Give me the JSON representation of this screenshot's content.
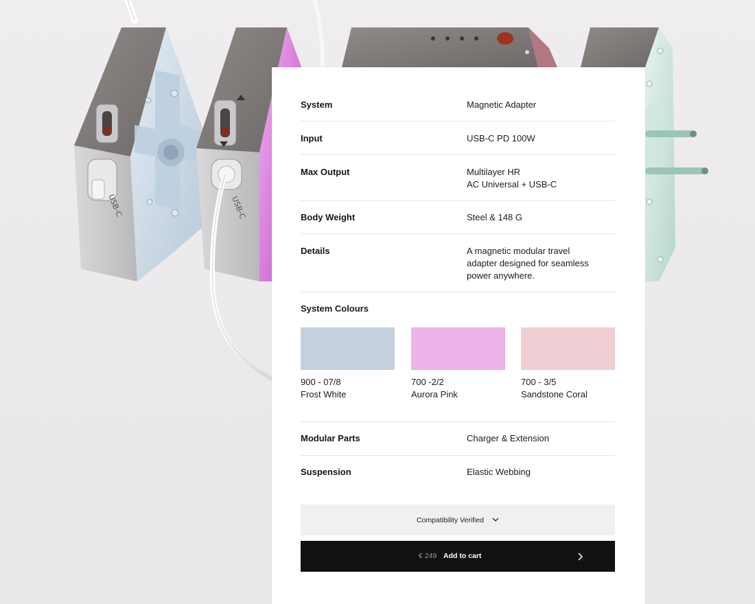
{
  "specs": [
    {
      "label": "System",
      "value": "Magnetic Adapter"
    },
    {
      "label": "Input",
      "value": "USB-C PD 100W"
    },
    {
      "label": "Max Output",
      "value_line1": "Multilayer HR",
      "value_line2": "AC Universal + USB-C"
    },
    {
      "label": "Body Weight",
      "value": "Steel & 148 G"
    },
    {
      "label": "Details",
      "value_line1": "A magnetic modular travel",
      "value_line2": "adapter designed for seamless",
      "value_line3": "power anywhere."
    }
  ],
  "colours": {
    "label": "System Colours",
    "swatches": [
      {
        "code": "900 - 07/8",
        "name": "Frost White",
        "color": "#c4d0dd"
      },
      {
        "code": "700 -2/2",
        "name": "Aurora Pink",
        "color": "#ecb4e8"
      },
      {
        "code": "700 - 3/5",
        "name": "Sandstone Coral",
        "color": "#f0cfd4"
      }
    ]
  },
  "specs_lower": [
    {
      "label": "Modular Parts",
      "value": "Charger & Extension"
    },
    {
      "label": "Suspension",
      "value": "Elastic Webbing"
    }
  ],
  "compatibility": {
    "label": "Compatibility Verified",
    "icon": "chevron-down-icon"
  },
  "cart": {
    "price": "€ 249",
    "label": "Add to cart",
    "icon": "chevron-right-icon"
  },
  "product_labels": {
    "port_a": "USB-C",
    "port_b": "USB-C"
  },
  "accent_colors": {
    "frost": "#c4d0dd",
    "aurora": "#d466d9",
    "sage": "#bfe0d6",
    "button": "#121112"
  }
}
